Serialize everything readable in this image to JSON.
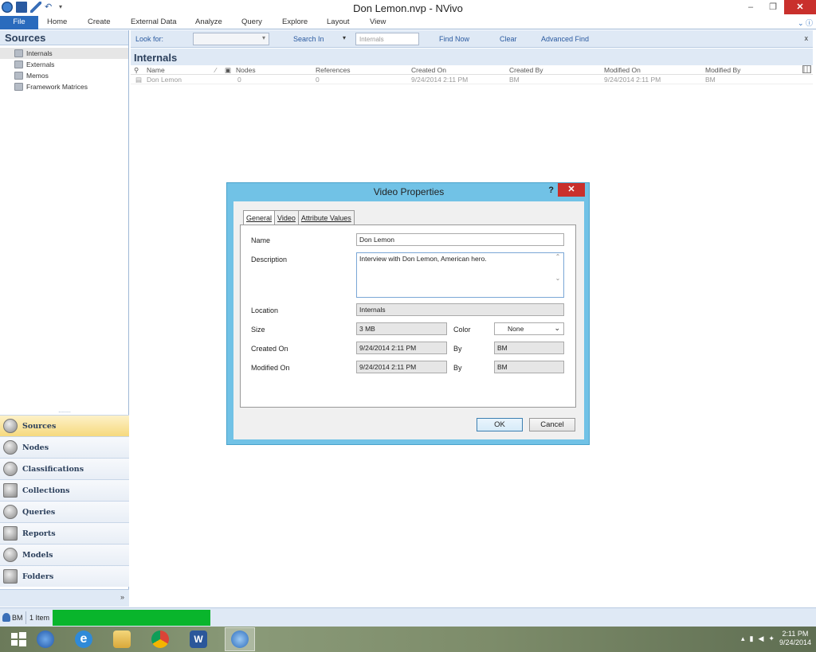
{
  "window": {
    "title": "Don Lemon.nvp - NVivo",
    "min": "–",
    "restore": "❐",
    "close": "✕"
  },
  "ribbon": {
    "file": "File",
    "tabs": [
      "Home",
      "Create",
      "External Data",
      "Analyze",
      "Query",
      "Explore",
      "Layout",
      "View"
    ]
  },
  "nav": {
    "title": "Sources",
    "tree": [
      "Internals",
      "Externals",
      "Memos",
      "Framework Matrices"
    ],
    "grip": "........",
    "buttons": [
      "Sources",
      "Nodes",
      "Classifications",
      "Collections",
      "Queries",
      "Reports",
      "Models",
      "Folders"
    ],
    "footer_chevron": "»"
  },
  "findbar": {
    "look_for": "Look for:",
    "search_in": "Search In",
    "search_in_arrow": "▾",
    "search_in_value": "Internals",
    "find_now": "Find Now",
    "clear": "Clear",
    "advanced_find": "Advanced Find",
    "close": "x"
  },
  "content": {
    "title": "Internals",
    "columns": [
      "Name",
      "Nodes",
      "References",
      "Created On",
      "Created By",
      "Modified On",
      "Modified By"
    ],
    "rows": [
      {
        "name": "Don Lemon",
        "nodes": "0",
        "references": "0",
        "created_on": "9/24/2014 2:11 PM",
        "created_by": "BM",
        "modified_on": "9/24/2014 2:11 PM",
        "modified_by": "BM"
      }
    ]
  },
  "dialog": {
    "title": "Video Properties",
    "help": "?",
    "close": "✕",
    "tabs": [
      "General",
      "Video",
      "Attribute Values"
    ],
    "labels": {
      "name": "Name",
      "description": "Description",
      "location": "Location",
      "size": "Size",
      "color": "Color",
      "created_on": "Created On",
      "modified_on": "Modified On",
      "by": "By"
    },
    "values": {
      "name": "Don Lemon",
      "description": "Interview with Don Lemon, American hero.",
      "location": "Internals",
      "size": "3 MB",
      "color": "None",
      "created_on": "9/24/2014 2:11 PM",
      "created_by": "BM",
      "modified_on": "9/24/2014 2:11 PM",
      "modified_by": "BM"
    },
    "ok": "OK",
    "cancel": "Cancel"
  },
  "status": {
    "user": "BM",
    "items": "1 Item"
  },
  "taskbar": {
    "time": "2:11 PM",
    "date": "9/24/2014"
  },
  "colors": {
    "accent": "#2a6bbd",
    "dialog_frame": "#71c2e6",
    "close_red": "#c9302c",
    "progress_green": "#09b52c"
  }
}
